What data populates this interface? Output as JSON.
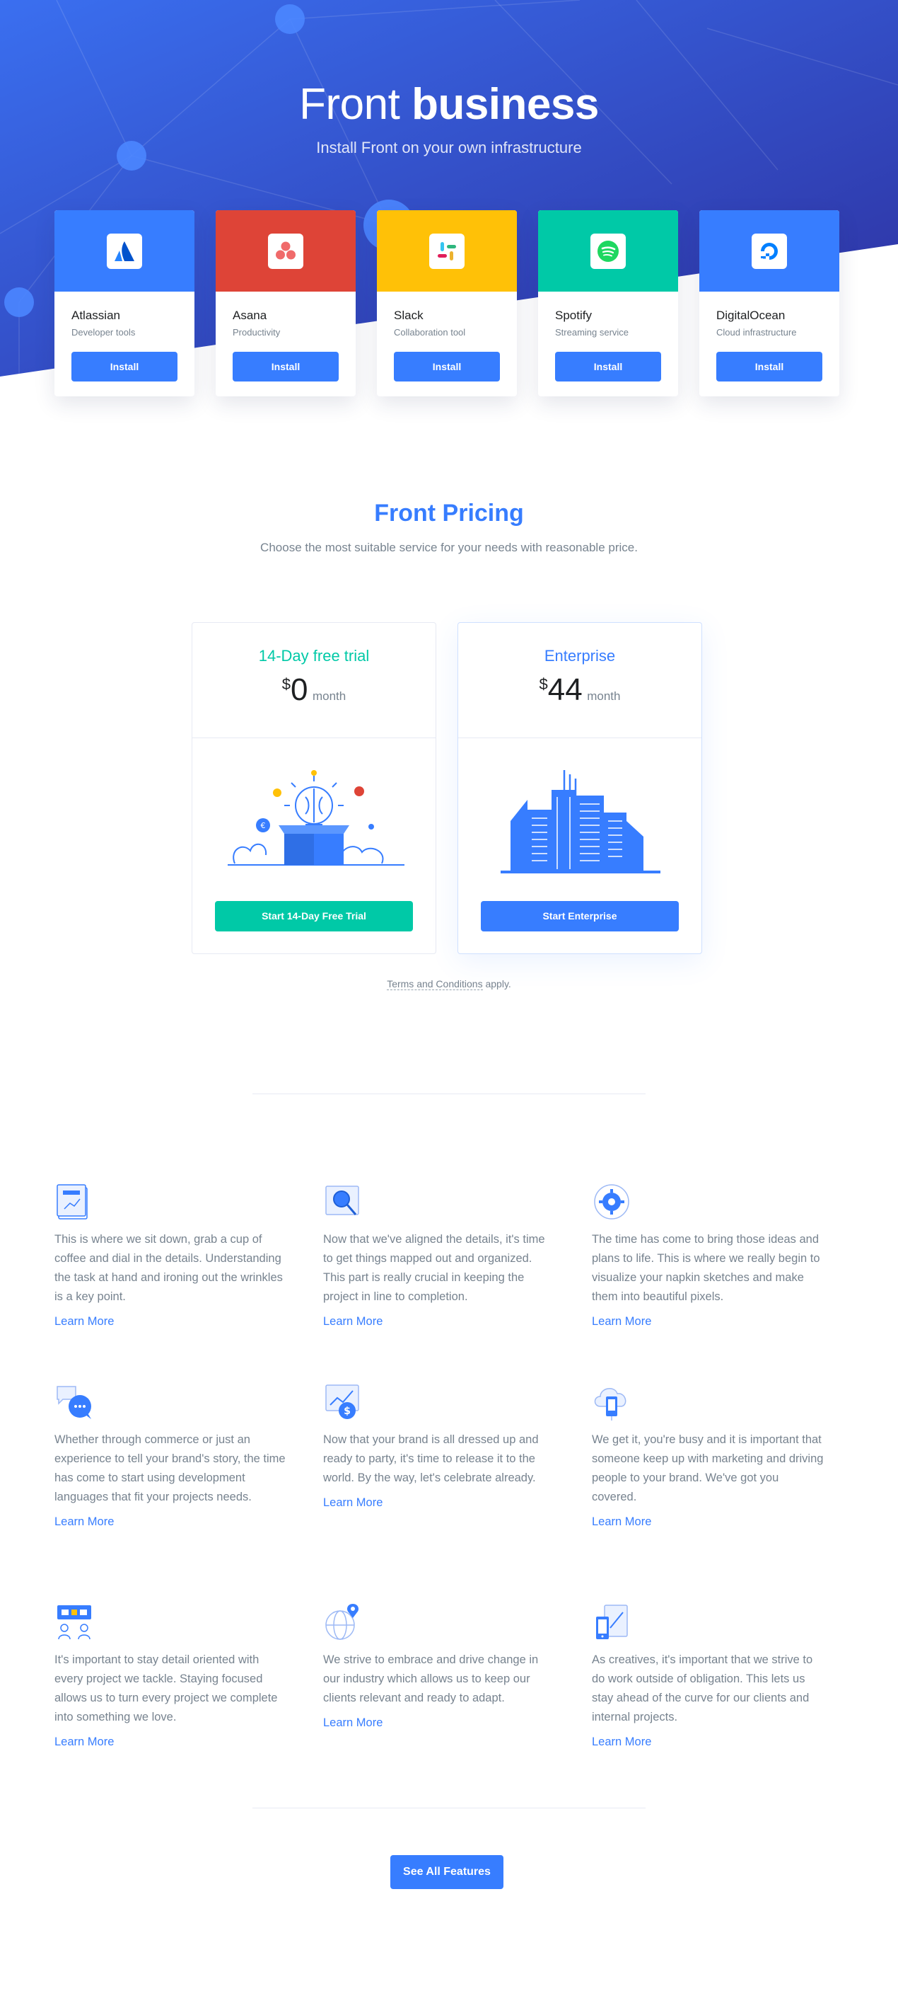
{
  "hero": {
    "title_light": "Front",
    "title_bold": "business",
    "subtitle": "Install Front on your own infrastructure",
    "gradient_start": "#3a6ff0",
    "gradient_end": "#2d2f9e"
  },
  "apps": [
    {
      "name": "Atlassian",
      "category": "Developer tools",
      "button": "Install",
      "color": "#377dff",
      "icon": "atlassian-logo-icon"
    },
    {
      "name": "Asana",
      "category": "Productivity",
      "button": "Install",
      "color": "#de4437",
      "icon": "asana-logo-icon"
    },
    {
      "name": "Slack",
      "category": "Collaboration tool",
      "button": "Install",
      "color": "#ffc107",
      "icon": "slack-logo-icon"
    },
    {
      "name": "Spotify",
      "category": "Streaming service",
      "button": "Install",
      "color": "#00c9a7",
      "icon": "spotify-logo-icon"
    },
    {
      "name": "DigitalOcean",
      "category": "Cloud infrastructure",
      "button": "Install",
      "color": "#377dff",
      "icon": "digitalocean-logo-icon"
    }
  ],
  "pricing": {
    "title_light": "Front",
    "title_bold": "Pricing",
    "subtitle": "Choose the most suitable service for your needs with reasonable price.",
    "plans": [
      {
        "name": "14-Day free trial",
        "currency": "$",
        "amount": "0",
        "period": "month",
        "button": "Start 14-Day Free Trial",
        "accent": "#00c9a7",
        "illustration": "brain-in-box-icon"
      },
      {
        "name": "Enterprise",
        "currency": "$",
        "amount": "44",
        "period": "month",
        "button": "Start Enterprise",
        "accent": "#377dff",
        "illustration": "city-buildings-icon"
      }
    ],
    "terms_link": "Terms and Conditions",
    "terms_suffix": " apply."
  },
  "features": [
    {
      "icon": "document-chart-icon",
      "text": "This is where we sit down, grab a cup of coffee and dial in the details. Understanding the task at hand and ironing out the wrinkles is a key point.",
      "link": "Learn More"
    },
    {
      "icon": "magnifier-window-icon",
      "text": "Now that we've aligned the details, it's time to get things mapped out and organized. This part is really crucial in keeping the project in line to completion.",
      "link": "Learn More"
    },
    {
      "icon": "gear-globe-icon",
      "text": "The time has come to bring those ideas and plans to life. This is where we really begin to visualize your napkin sketches and make them into beautiful pixels.",
      "link": "Learn More"
    },
    {
      "icon": "chat-bubbles-icon",
      "text": "Whether through commerce or just an experience to tell your brand's story, the time has come to start using development languages that fit your projects needs.",
      "link": "Learn More"
    },
    {
      "icon": "growth-chart-dollar-icon",
      "text": "Now that your brand is all dressed up and ready to party, it's time to release it to the world. By the way, let's celebrate already.",
      "link": "Learn More"
    },
    {
      "icon": "cloud-mobile-icon",
      "text": "We get it, you're busy and it is important that someone keep up with marketing and driving people to your brand. We've got you covered.",
      "link": "Learn More"
    },
    {
      "icon": "team-collaboration-icon",
      "text": "It's important to stay detail oriented with every project we tackle. Staying focused allows us to turn every project we complete into something we love.",
      "link": "Learn More"
    },
    {
      "icon": "globe-location-icon",
      "text": "We strive to embrace and drive change in our industry which allows us to keep our clients relevant and ready to adapt.",
      "link": "Learn More"
    },
    {
      "icon": "mobile-tablet-icon",
      "text": "As creatives, it's important that we strive to do work outside of obligation. This lets us stay ahead of the curve for our clients and internal projects.",
      "link": "Learn More"
    }
  ],
  "see_all_button": "See All Features"
}
